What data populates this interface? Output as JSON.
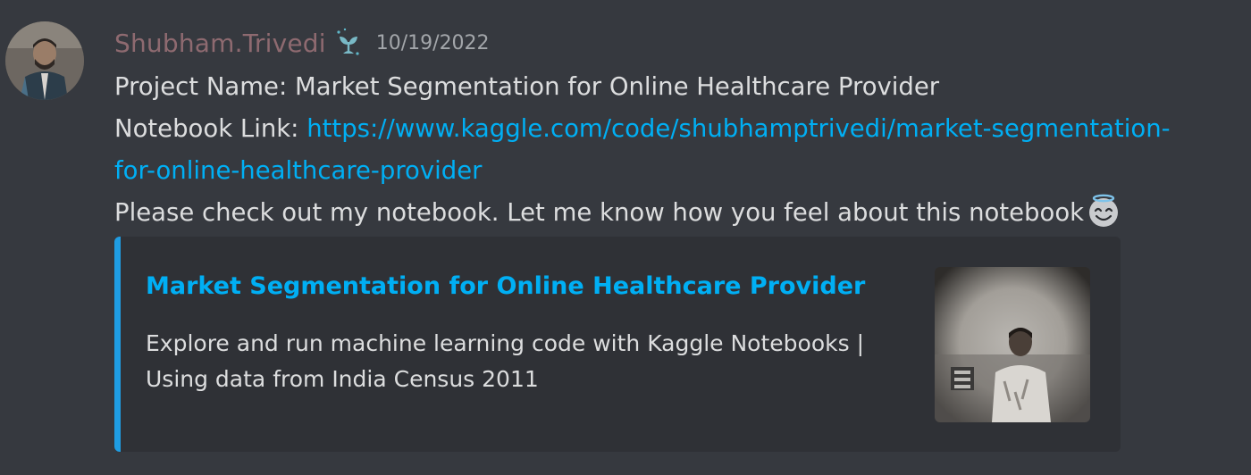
{
  "message": {
    "author": {
      "username": "Shubham.Trivedi",
      "name_color": "#8e6a70",
      "avatar_icon": "user-avatar",
      "badge_icon": "sprout-badge-icon"
    },
    "timestamp": "10/19/2022",
    "lines": {
      "project": "Project Name: Market Segmentation for Online Healthcare Provider",
      "link_prefix": "Notebook Link: ",
      "link_part1": "https://www.kaggle.com/code/shubhamptrivedi/market-segmentation-",
      "link_part2": "for-online-healthcare-provider",
      "closing": "Please check out my notebook. Let me know how you feel about this notebook",
      "emoji": "smiling-face-with-halo"
    }
  },
  "embed": {
    "title": "Market Segmentation for Online Healthcare Provider",
    "description_line1": "Explore and run machine learning code with Kaggle Notebooks |",
    "description_line2": "Using data from India Census 2011",
    "accent_color": "#1f9de3",
    "thumbnail_icon": "profile-photo-thumbnail"
  },
  "theme": {
    "background": "#36393f",
    "embed_background": "#2f3136",
    "link_color": "#00aff4",
    "text_color": "#dcddde",
    "muted_color": "#a3a6aa"
  }
}
